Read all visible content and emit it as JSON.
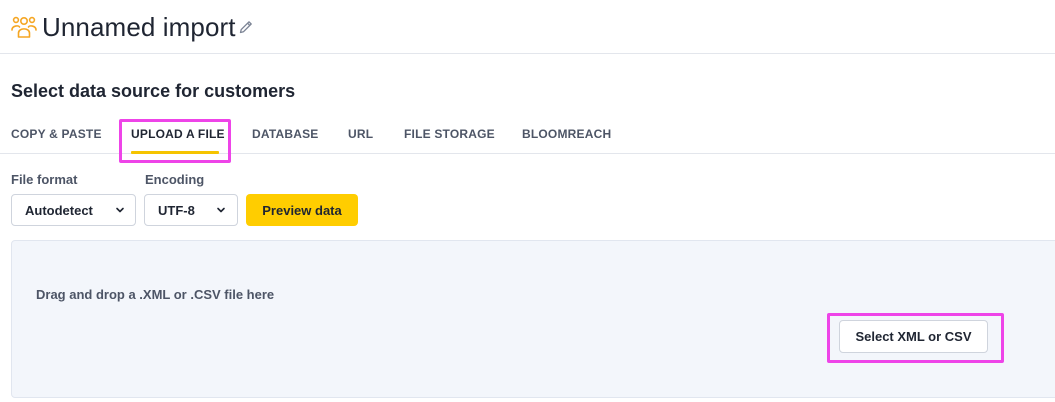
{
  "header": {
    "icon": "users-icon",
    "title": "Unnamed import",
    "edit_icon": "pencil-icon",
    "accent_color": "#f5a623"
  },
  "section": {
    "title": "Select data source for customers"
  },
  "tabs": [
    {
      "label": "COPY & PASTE",
      "active": false
    },
    {
      "label": "UPLOAD A FILE",
      "active": true
    },
    {
      "label": "DATABASE",
      "active": false
    },
    {
      "label": "URL",
      "active": false
    },
    {
      "label": "FILE STORAGE",
      "active": false
    },
    {
      "label": "BLOOMREACH",
      "active": false
    }
  ],
  "form": {
    "file_format": {
      "label": "File format",
      "value": "Autodetect"
    },
    "encoding": {
      "label": "Encoding",
      "value": "UTF-8"
    },
    "preview_label": "Preview data"
  },
  "dropzone": {
    "text": "Drag and drop a .XML or .CSV file here",
    "button_label": "Select XML or CSV"
  },
  "colors": {
    "primary_button": "#ffcd00",
    "active_tab_underline": "#f5c400",
    "highlight": "#ee44e8",
    "dropzone_bg": "#f3f6fb"
  }
}
